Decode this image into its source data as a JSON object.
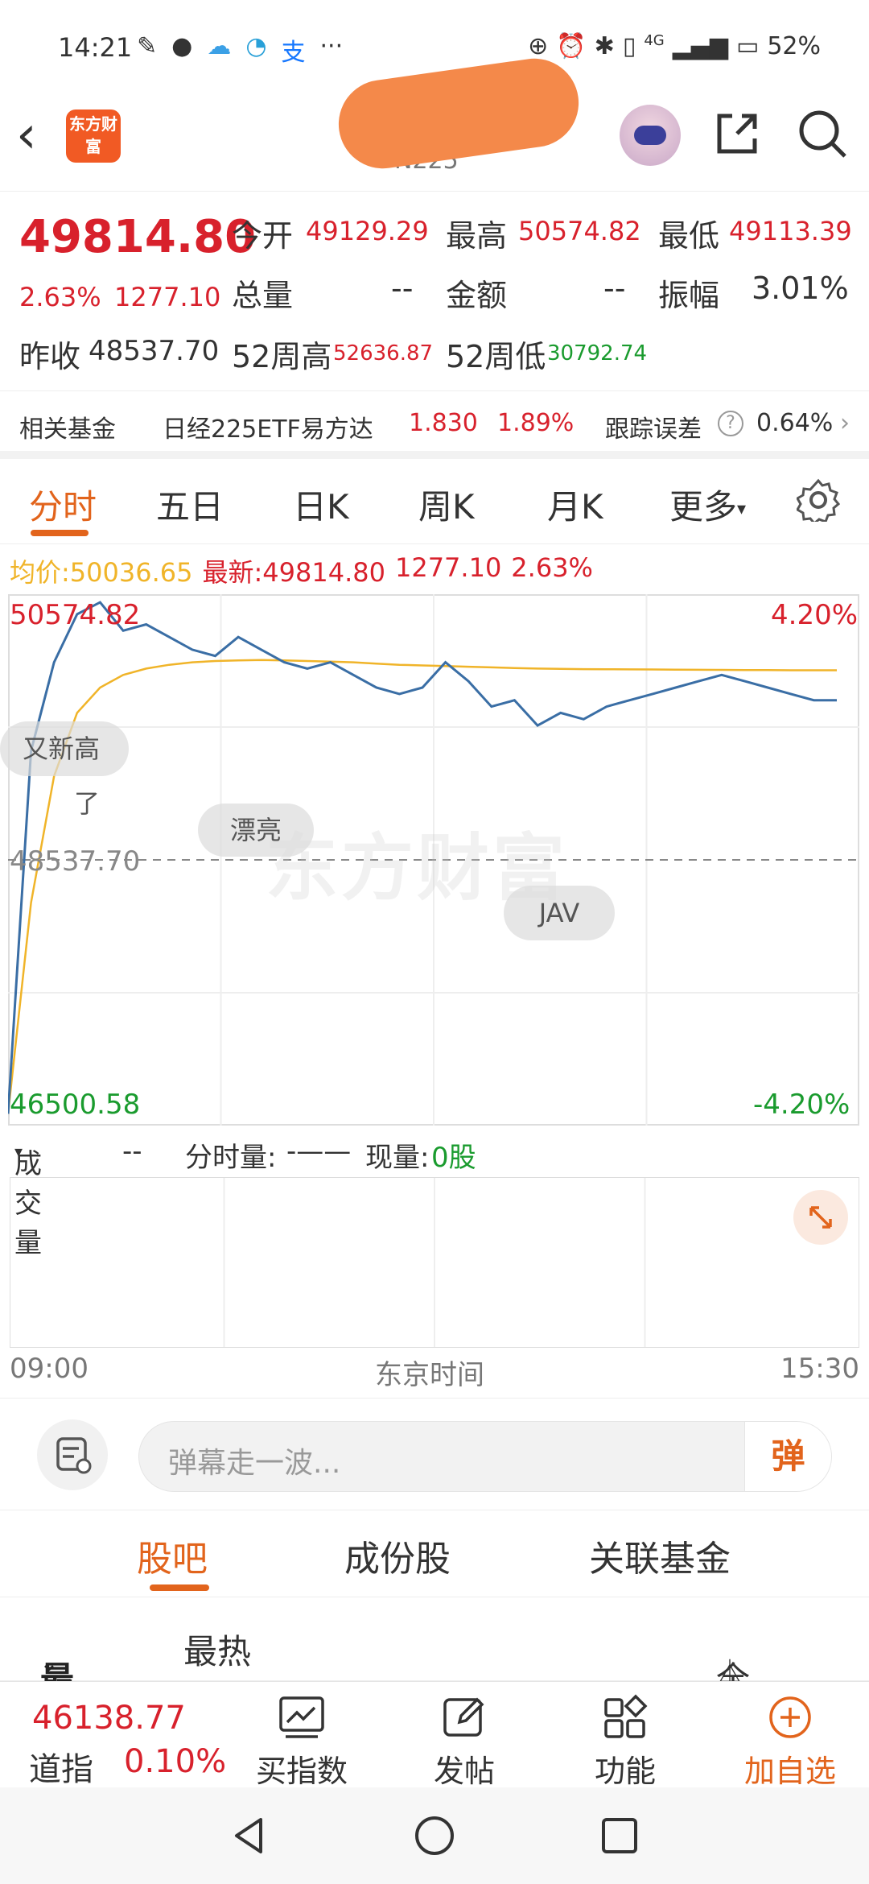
{
  "status_bar": {
    "time": "14:21",
    "battery": "52%",
    "net": "4G"
  },
  "nav": {
    "logo_text": "东方财富",
    "subtitle": "N225"
  },
  "quote": {
    "price": "49814.80",
    "change_pct": "2.63%",
    "change": "1277.10",
    "open_label": "今开",
    "open": "49129.29",
    "high_label": "最高",
    "high": "50574.82",
    "low_label": "最低",
    "low": "49113.39",
    "vol_label": "总量",
    "vol": "--",
    "amount_label": "金额",
    "amount": "--",
    "amp_label": "振幅",
    "amp": "3.01%",
    "prev_label": "昨收",
    "prev": "48537.70",
    "w52h_label": "52周高",
    "w52h": "52636.87",
    "w52l_label": "52周低",
    "w52l": "30792.74"
  },
  "fund": {
    "label": "相关基金",
    "name": "日经225ETF易方达",
    "price": "1.830",
    "pct": "1.89%",
    "te_label": "跟踪误差",
    "te": "0.64%"
  },
  "tabs": [
    "分时",
    "五日",
    "日K",
    "周K",
    "月K",
    "更多"
  ],
  "avg_info": {
    "avg_label": "均价:",
    "avg": "50036.65",
    "latest_label": "最新:",
    "latest": "49814.80",
    "chg": "1277.10",
    "pct": "2.63%"
  },
  "chart_labels": {
    "top_left": "50574.82",
    "top_right": "4.20%",
    "mid": "48537.70",
    "bottom_left": "46500.58",
    "bottom_right": "-4.20%",
    "watermark": "东方财富"
  },
  "danmu": [
    "又新高了",
    "漂亮",
    "JAV"
  ],
  "volume": {
    "select": "成交量",
    "val": "--",
    "fsl_label": "分时量:",
    "fsl": "-——",
    "xl_label": "现量:",
    "xl": "0股"
  },
  "time_axis": {
    "start": "09:00",
    "mid": "东京时间",
    "end": "15:30"
  },
  "danmu_input": {
    "placeholder": "弹幕走一波...",
    "btn": "弹"
  },
  "sub_tabs": [
    "股吧",
    "成份股",
    "关联基金"
  ],
  "filter": {
    "latest": "最新",
    "hot": "最热",
    "all": "全部"
  },
  "bottom": {
    "dji_price": "46138.77",
    "dji_label": "道指",
    "dji_pct": "0.10%",
    "buy": "买指数",
    "post": "发帖",
    "func": "功能",
    "add": "加自选"
  },
  "colors": {
    "up": "#d8212c",
    "down": "#1a9b2e",
    "accent": "#e2641c",
    "price_line": "#3a6ea5",
    "avg_line": "#f0b429"
  },
  "chart_data": {
    "type": "line",
    "title": "",
    "ylim": [
      46500.58,
      50574.82
    ],
    "prev_close": 48537.7,
    "x_range": [
      "09:00",
      "15:30"
    ],
    "series": [
      {
        "name": "最新",
        "values": [
          46530,
          49400,
          50100,
          50480,
          50574,
          50350,
          50400,
          50300,
          50200,
          50150,
          50300,
          50200,
          50100,
          50050,
          50100,
          50000,
          49900,
          49850,
          49900,
          50100,
          49950,
          49750,
          49800,
          49600,
          49700,
          49650,
          49750,
          49800,
          49850,
          49900,
          49950,
          50000,
          49950,
          49900,
          49850,
          49800,
          49800
        ]
      },
      {
        "name": "均价",
        "values": [
          46530,
          48200,
          49200,
          49700,
          49900,
          50000,
          50050,
          50080,
          50100,
          50110,
          50115,
          50118,
          50115,
          50110,
          50105,
          50100,
          50090,
          50080,
          50075,
          50070,
          50065,
          50060,
          50055,
          50050,
          50048,
          50046,
          50045,
          50044,
          50043,
          50042,
          50041,
          50040,
          50039,
          50038,
          50037,
          50037,
          50036.65
        ]
      }
    ]
  }
}
